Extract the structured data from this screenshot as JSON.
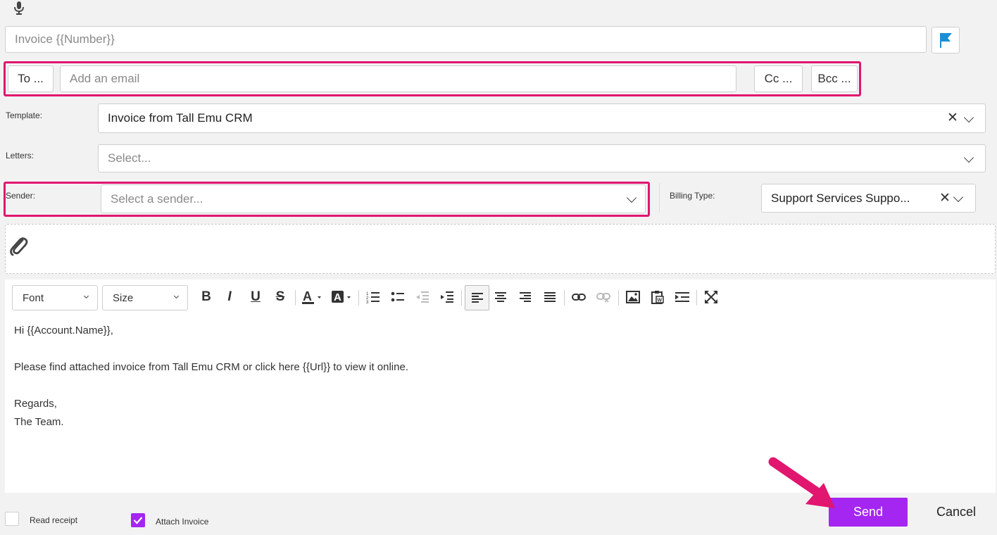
{
  "subject": {
    "placeholder": "Invoice {{Number}}"
  },
  "recipients": {
    "to_label": "To ...",
    "email_placeholder": "Add an email",
    "cc_label": "Cc ...",
    "bcc_label": "Bcc ..."
  },
  "template": {
    "label": "Template:",
    "value": "Invoice from Tall Emu CRM"
  },
  "letters": {
    "label": "Letters:",
    "placeholder": "Select..."
  },
  "sender": {
    "label": "Sender:",
    "placeholder": "Select a sender..."
  },
  "billing": {
    "label": "Billing Type:",
    "value": "Support Services Suppo..."
  },
  "editor": {
    "font_label": "Font",
    "size_label": "Size",
    "lines": [
      "Hi {{Account.Name}},",
      "Please find attached invoice from Tall Emu CRM or click here {{Url}} to view it online.",
      "Regards,",
      "The Team."
    ]
  },
  "footer": {
    "read_receipt": "Read receipt",
    "attach_invoice": "Attach Invoice",
    "send": "Send",
    "cancel": "Cancel"
  },
  "options": {
    "read_receipt_checked": false,
    "attach_invoice_checked": true
  },
  "colors": {
    "accent": "#a526f0",
    "highlight": "#e0166f",
    "flag": "#1a8fd6"
  },
  "icons": [
    "microphone-icon",
    "flag-icon",
    "paperclip-icon",
    "bold-icon",
    "italic-icon",
    "underline-icon",
    "strikethrough-icon",
    "font-color-icon",
    "background-color-icon",
    "ordered-list-icon",
    "unordered-list-icon",
    "outdent-icon",
    "indent-icon",
    "align-left-icon",
    "align-center-icon",
    "align-right-icon",
    "justify-icon",
    "link-icon",
    "unlink-icon",
    "image-icon",
    "paste-word-icon",
    "insert-field-icon",
    "fullscreen-icon",
    "arrow-annotation-icon"
  ]
}
